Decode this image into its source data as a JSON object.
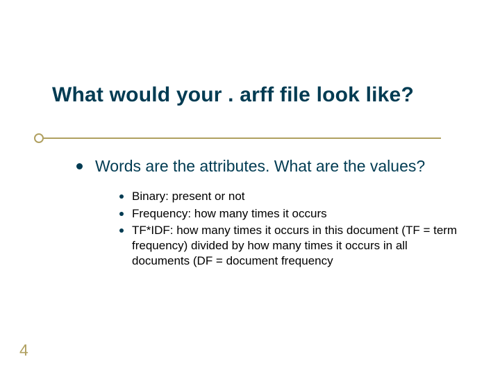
{
  "slide": {
    "title": "What would your . arff file look like?",
    "pageNumber": "4"
  },
  "bullets": {
    "main": "Words are the attributes. What are the values?",
    "subs": [
      "Binary: present or not",
      "Frequency: how many times it occurs",
      "TF*IDF: how many times it occurs in this document (TF = term frequency) divided by how many times it occurs in all documents (DF = document frequency"
    ]
  },
  "colors": {
    "primary": "#003b52",
    "accent": "#b0a060"
  }
}
